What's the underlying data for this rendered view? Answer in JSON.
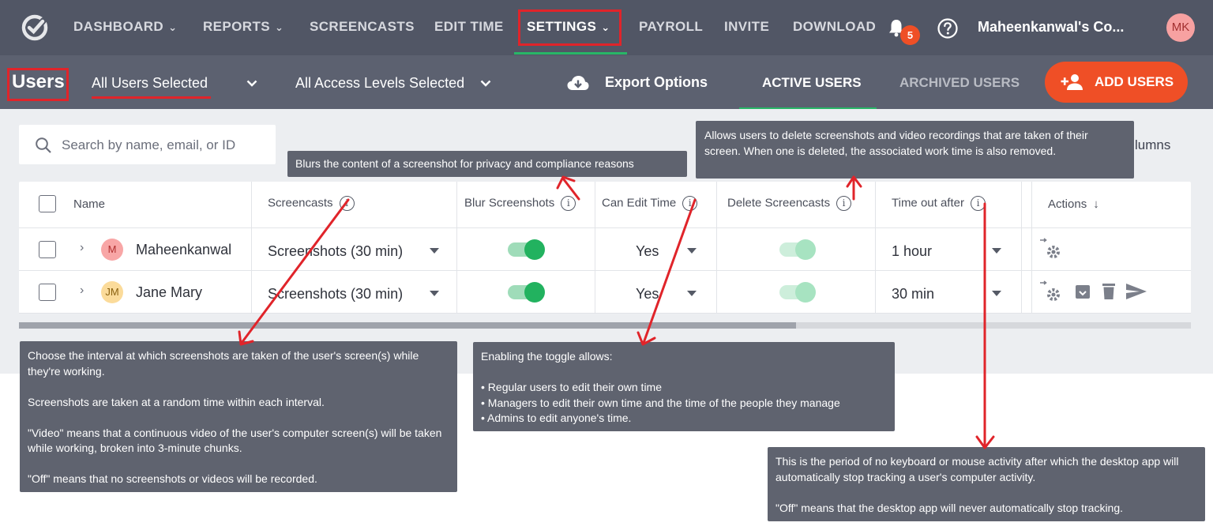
{
  "nav": {
    "items": [
      {
        "label": "DASHBOARD",
        "has_chevron": true
      },
      {
        "label": "REPORTS",
        "has_chevron": true
      },
      {
        "label": "SCREENCASTS",
        "has_chevron": false
      },
      {
        "label": "EDIT TIME",
        "has_chevron": false
      },
      {
        "label": "SETTINGS",
        "has_chevron": true,
        "active": true
      },
      {
        "label": "PAYROLL",
        "has_chevron": false
      },
      {
        "label": "INVITE",
        "has_chevron": false
      },
      {
        "label": "DOWNLOAD",
        "has_chevron": false
      }
    ],
    "chevron": "⌄",
    "notification_count": "5",
    "company": "Maheenkanwal's Co...",
    "avatar_initials": "MK"
  },
  "subbar": {
    "title": "Users",
    "user_filter": "All Users Selected",
    "access_filter": "All Access Levels Selected",
    "export": "Export Options",
    "tab_active": "ACTIVE USERS",
    "tab_archived": "ARCHIVED USERS",
    "add_button": "ADD USERS"
  },
  "search": {
    "placeholder": "Search by name, email, or ID"
  },
  "columns_label": "lumns",
  "table": {
    "headers": {
      "name": "Name",
      "screencasts": "Screencasts",
      "blur": "Blur Screenshots",
      "edit_time": "Can Edit Time",
      "delete": "Delete Screencasts",
      "timeout": "Time out after",
      "actions": "Actions"
    },
    "rows": [
      {
        "initials": "M",
        "name": "Maheenkanwal",
        "screencasts": "Screenshots (30 min)",
        "blur": true,
        "edit_time": "Yes",
        "delete": true,
        "timeout": "1 hour"
      },
      {
        "initials": "JM",
        "name": "Jane Mary",
        "screencasts": "Screenshots (30 min)",
        "blur": true,
        "edit_time": "Yes",
        "delete": true,
        "timeout": "30 min"
      }
    ]
  },
  "tooltips": {
    "blur": "Blurs the content of a screenshot for privacy and compliance reasons",
    "delete": "Allows users to delete screenshots and video recordings that are taken of their screen. When one is deleted, the associated work time is also removed.",
    "screencasts": "Choose the interval at which screenshots are taken of the user's screen(s) while they're working.\n\nScreenshots are taken at a random time within each interval.\n\n\"Video\" means that a continuous video of the user's computer screen(s) will be taken while working, broken into 3-minute chunks.\n\n\"Off\" means that no screenshots or videos will be recorded.",
    "edit_time": "Enabling the toggle allows:\n\n• Regular users to edit their own time\n• Managers to edit their own time and the time of the people they manage\n• Admins to edit anyone's time.",
    "timeout": "This is the period of no keyboard or mouse activity after which the desktop app will automatically stop tracking a user's computer activity.\n\n\"Off\" means that the desktop app will never automatically stop tracking."
  },
  "colors": {
    "nav_bg": "#515665",
    "subbar_bg": "#5c6170",
    "accent_orange": "#ef4f26",
    "accent_green": "#28b667",
    "annotation_red": "#e0242a",
    "tooltip_bg": "#5f636f",
    "toggle_on": "#22b25f",
    "toggle_disabled": "#a7e3c1"
  }
}
